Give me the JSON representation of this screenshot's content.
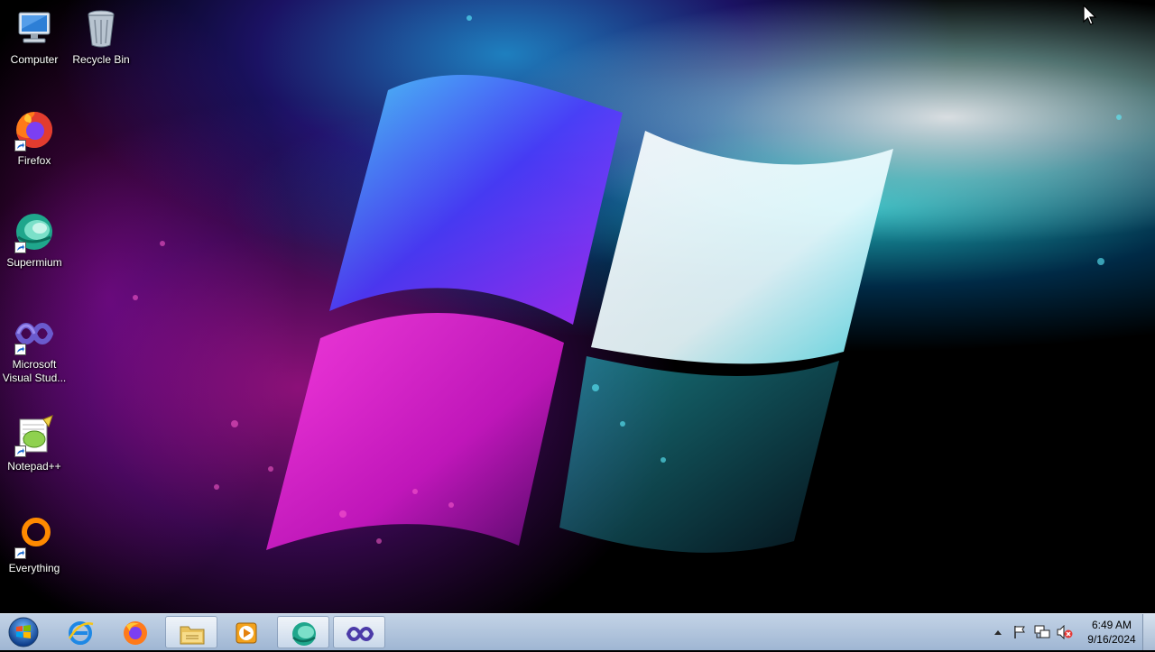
{
  "desktop": {
    "icons": [
      {
        "label": "Computer",
        "icon": "computer-icon"
      },
      {
        "label": "Recycle Bin",
        "icon": "recycle-bin-icon"
      },
      {
        "label": "Firefox",
        "icon": "firefox-icon"
      },
      {
        "label": "Supermium",
        "icon": "supermium-icon"
      },
      {
        "label": "Microsoft Visual Stud...",
        "icon": "visual-studio-icon"
      },
      {
        "label": "Notepad++",
        "icon": "notepad-plus-plus-icon"
      },
      {
        "label": "Everything",
        "icon": "everything-search-icon"
      }
    ]
  },
  "taskbar": {
    "pinned": [
      {
        "icon": "internet-explorer-icon",
        "open": false
      },
      {
        "icon": "firefox-icon",
        "open": false
      },
      {
        "icon": "file-explorer-icon",
        "open": true
      },
      {
        "icon": "media-player-icon",
        "open": false
      },
      {
        "icon": "supermium-icon",
        "open": true
      },
      {
        "icon": "visual-studio-icon",
        "open": true
      }
    ],
    "tray": {
      "icons": [
        "show-hidden-icons-icon",
        "action-center-flag-icon",
        "network-icon",
        "volume-muted-icon"
      ],
      "clock": {
        "time": "6:49 AM",
        "date": "9/16/2024"
      }
    }
  },
  "colors": {
    "taskbar_top": "#c3d3e6",
    "taskbar_bottom": "#9fb6d3",
    "desktop_bg": "#000000"
  }
}
